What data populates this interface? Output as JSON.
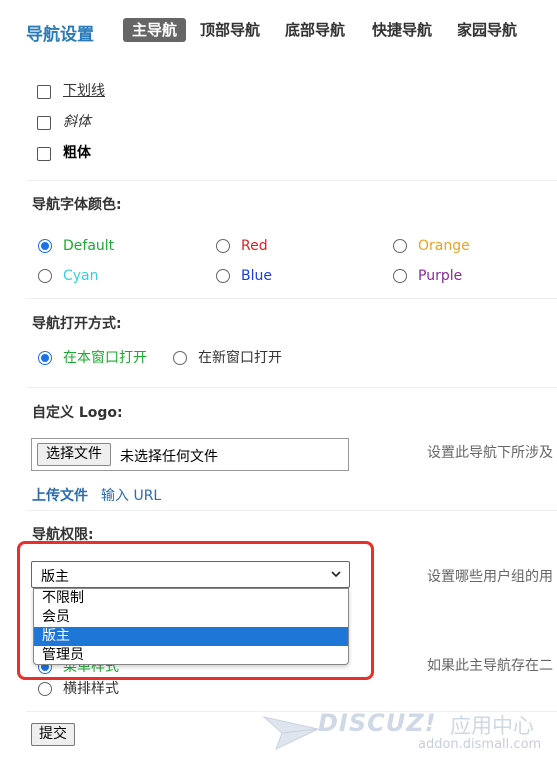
{
  "header": {
    "title": "导航设置",
    "tabs": [
      {
        "label": "主导航",
        "active": true
      },
      {
        "label": "顶部导航",
        "active": false
      },
      {
        "label": "底部导航",
        "active": false
      },
      {
        "label": "快捷导航",
        "active": false
      },
      {
        "label": "家园导航",
        "active": false
      }
    ]
  },
  "font_style": {
    "options": [
      {
        "label": "下划线",
        "checked": false
      },
      {
        "label": "斜体",
        "checked": false
      },
      {
        "label": "粗体",
        "checked": false
      }
    ]
  },
  "font_color": {
    "title": "导航字体颜色:",
    "options": [
      {
        "label": "Default",
        "color": "#1aab2e",
        "checked": true
      },
      {
        "label": "Red",
        "color": "#e02020",
        "checked": false
      },
      {
        "label": "Orange",
        "color": "#f0a020",
        "checked": false
      },
      {
        "label": "Cyan",
        "color": "#30d0e0",
        "checked": false
      },
      {
        "label": "Blue",
        "color": "#1a3ce0",
        "checked": false
      },
      {
        "label": "Purple",
        "color": "#8a2a9a",
        "checked": false
      }
    ]
  },
  "open_mode": {
    "title": "导航打开方式:",
    "options": [
      {
        "label": "在本窗口打开",
        "color": "#1aab2e",
        "checked": true
      },
      {
        "label": "在新窗口打开",
        "color": "#333333",
        "checked": false
      }
    ]
  },
  "logo": {
    "title": "自定义 Logo:",
    "file_button": "选择文件",
    "file_status": "未选择任何文件",
    "upload_link": "上传文件",
    "url_link": "输入 URL",
    "hint": "设置此导航下所涉及"
  },
  "permission": {
    "title": "导航权限:",
    "selected": "版主",
    "options": [
      "不限制",
      "会员",
      "版主",
      "管理员"
    ],
    "hint": "设置哪些用户组的用"
  },
  "style": {
    "partial_option": "菜单样式",
    "option2": "横排样式",
    "hint": "如果此主导航存在二"
  },
  "submit_label": "提交",
  "watermark": {
    "brand": "DISCUZ!",
    "cn": "应用中心",
    "url": "addon.dismall.com"
  },
  "colors": {
    "accent_title": "#2b7bb9",
    "highlight": "#e8302a",
    "selected_option": "#1e76d6"
  }
}
